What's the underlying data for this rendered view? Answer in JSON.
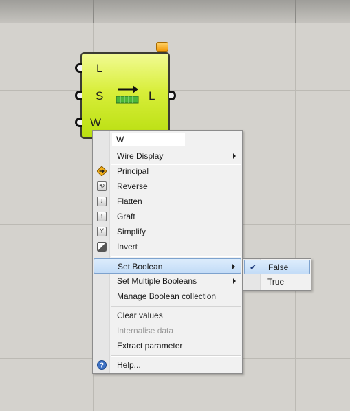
{
  "component": {
    "inputs": [
      "L",
      "S",
      "W"
    ],
    "output": "L"
  },
  "menu": {
    "name_value": "W",
    "items": [
      {
        "label": "Wire Display",
        "submenu": true,
        "icon": null
      },
      {
        "label": "Principal",
        "icon": "principal-icon"
      },
      {
        "label": "Reverse",
        "icon": "reverse-icon"
      },
      {
        "label": "Flatten",
        "icon": "flatten-icon"
      },
      {
        "label": "Graft",
        "icon": "graft-icon"
      },
      {
        "label": "Simplify",
        "icon": "simplify-icon"
      },
      {
        "label": "Invert",
        "icon": "invert-icon"
      },
      {
        "label": "Set Boolean",
        "submenu": true,
        "highlighted": true
      },
      {
        "label": "Set Multiple Booleans",
        "submenu": true
      },
      {
        "label": "Manage Boolean collection"
      },
      {
        "label": "Clear values"
      },
      {
        "label": "Internalise data",
        "disabled": true
      },
      {
        "label": "Extract parameter"
      },
      {
        "label": "Help...",
        "icon": "help-icon"
      }
    ]
  },
  "submenu": {
    "items": [
      {
        "label": "False",
        "checked": true,
        "highlighted": true
      },
      {
        "label": "True",
        "checked": false
      }
    ]
  },
  "colors": {
    "canvas": "#d4d2cd",
    "component_fill": "#c6e51f",
    "highlight": "#c3dcf7"
  }
}
